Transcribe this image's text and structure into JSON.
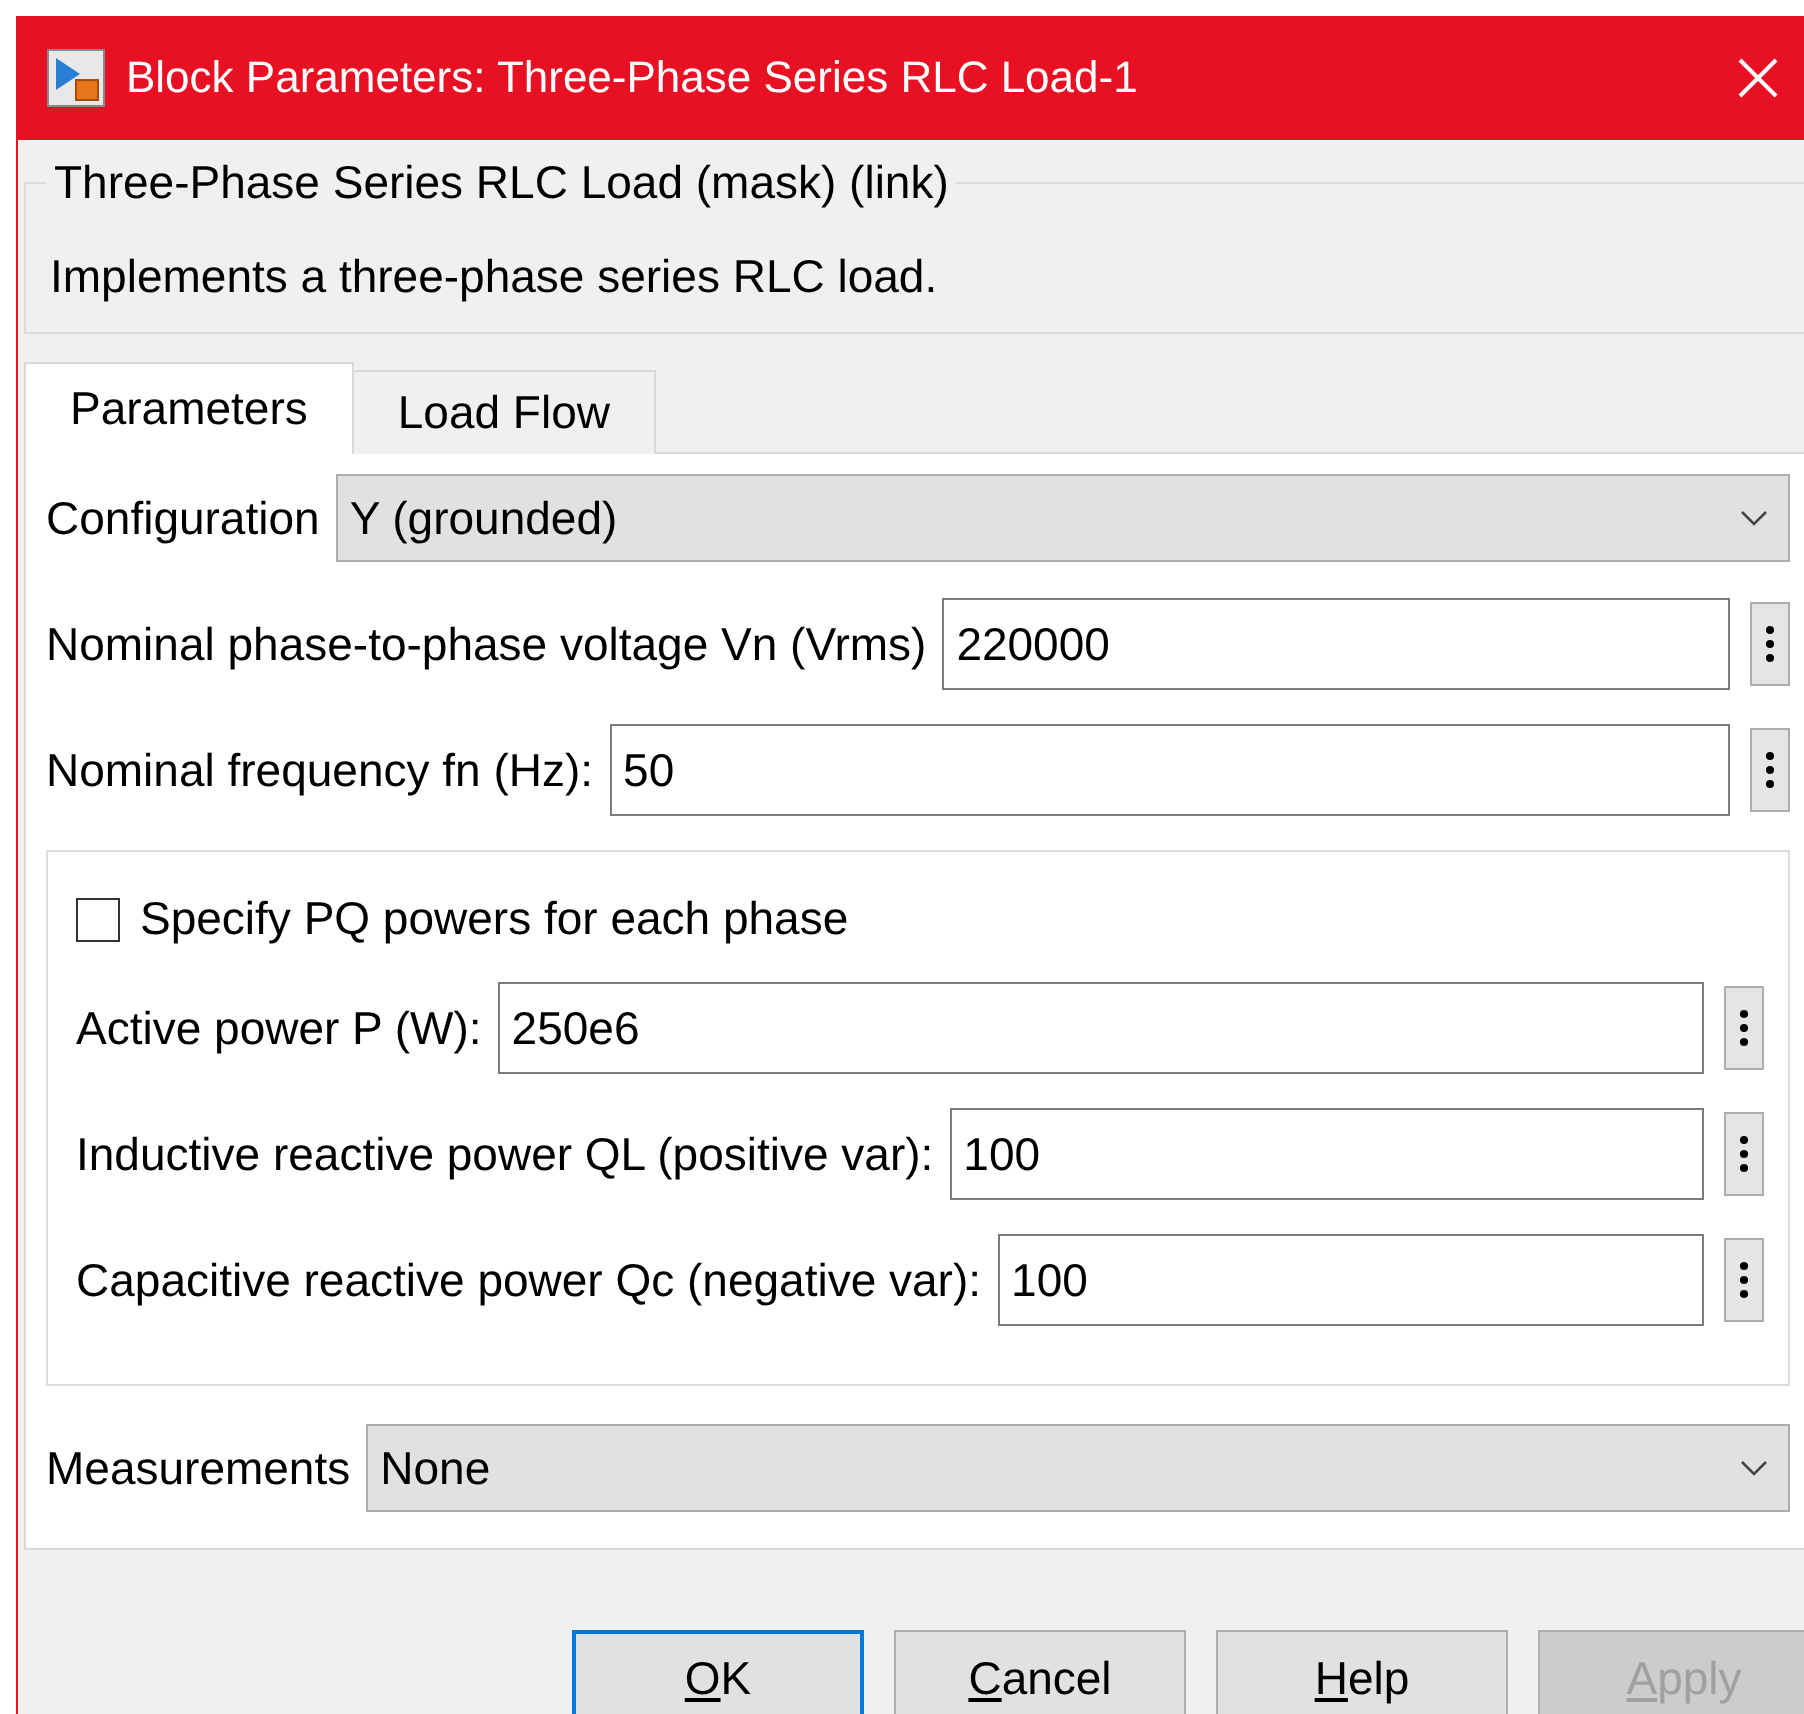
{
  "window": {
    "title": "Block Parameters: Three-Phase Series RLC Load-1"
  },
  "mask": {
    "title": "Three-Phase Series RLC Load (mask) (link)",
    "description": "Implements a three-phase series RLC load."
  },
  "tabs": [
    {
      "label": "Parameters",
      "selected": true
    },
    {
      "label": "Load Flow",
      "selected": false
    }
  ],
  "parameters": [
    {
      "kind": "dropdown",
      "label": "Configuration",
      "value": "Y (grounded)"
    },
    {
      "kind": "field",
      "label": "Nominal phase-to-phase voltage Vn (Vrms)",
      "value": "220000"
    },
    {
      "kind": "field",
      "label": "Nominal frequency fn (Hz):",
      "value": "50"
    }
  ],
  "pq_group": {
    "checkbox": {
      "label": "Specify PQ powers for each phase",
      "checked": false
    },
    "fields": [
      {
        "label": "Active power P (W):",
        "value": "250e6"
      },
      {
        "label": "Inductive reactive power QL (positive var):",
        "value": "100"
      },
      {
        "label": "Capacitive reactive power Qc (negative var):",
        "value": "100"
      }
    ]
  },
  "measurements": {
    "label": "Measurements",
    "value": "None"
  },
  "buttons": [
    {
      "label": "OK",
      "default": true,
      "disabled": false
    },
    {
      "label": "Cancel",
      "default": false,
      "disabled": false
    },
    {
      "label": "Help",
      "default": false,
      "disabled": false
    },
    {
      "label": "Apply",
      "default": false,
      "disabled": true
    }
  ]
}
